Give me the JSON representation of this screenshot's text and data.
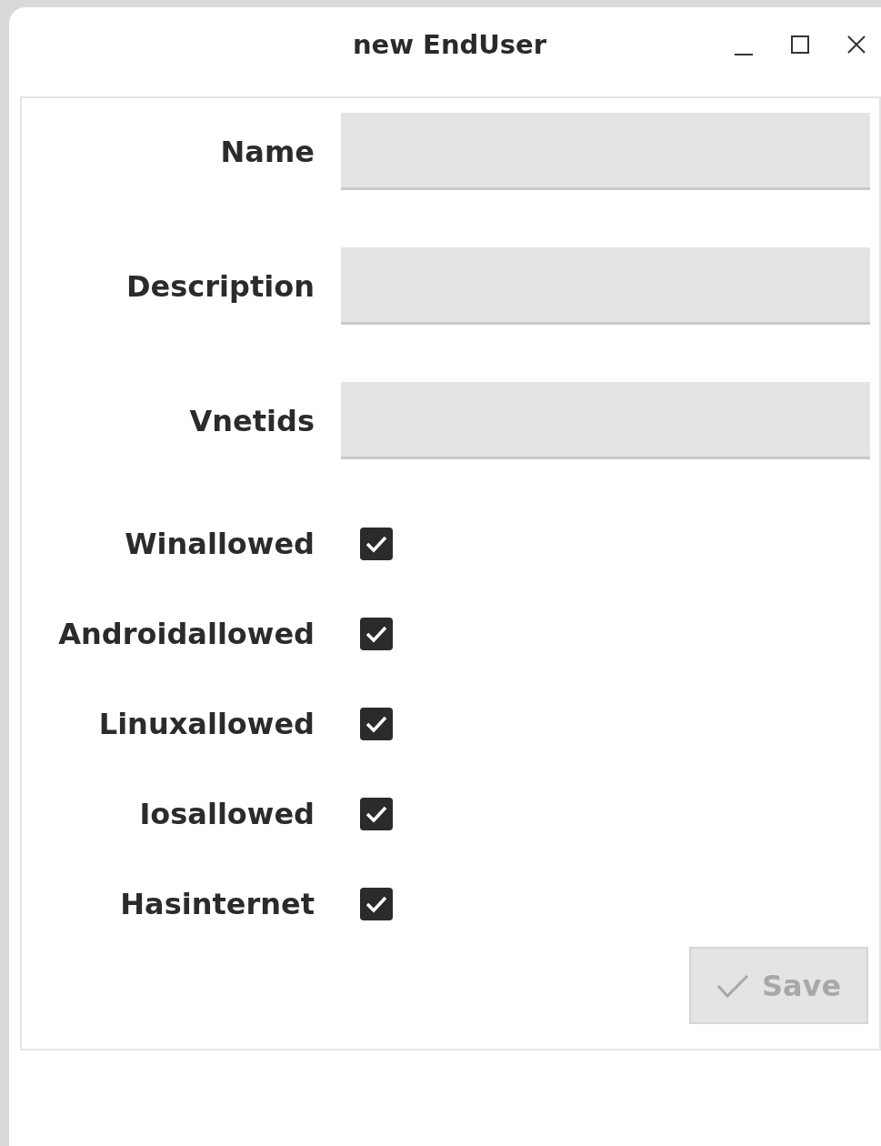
{
  "window": {
    "title": "new EndUser"
  },
  "fields": [
    {
      "kind": "text",
      "label": "Name"
    },
    {
      "kind": "text",
      "label": "Description"
    },
    {
      "kind": "text",
      "label": "Vnetids"
    },
    {
      "kind": "checkbox",
      "label": "Winallowed",
      "checked": true
    },
    {
      "kind": "checkbox",
      "label": "Androidallowed",
      "checked": true
    },
    {
      "kind": "checkbox",
      "label": "Linuxallowed",
      "checked": true
    },
    {
      "kind": "checkbox",
      "label": "Iosallowed",
      "checked": true
    },
    {
      "kind": "checkbox",
      "label": "Hasinternet",
      "checked": true
    }
  ],
  "save_button": {
    "label": "Save",
    "disabled": true
  }
}
